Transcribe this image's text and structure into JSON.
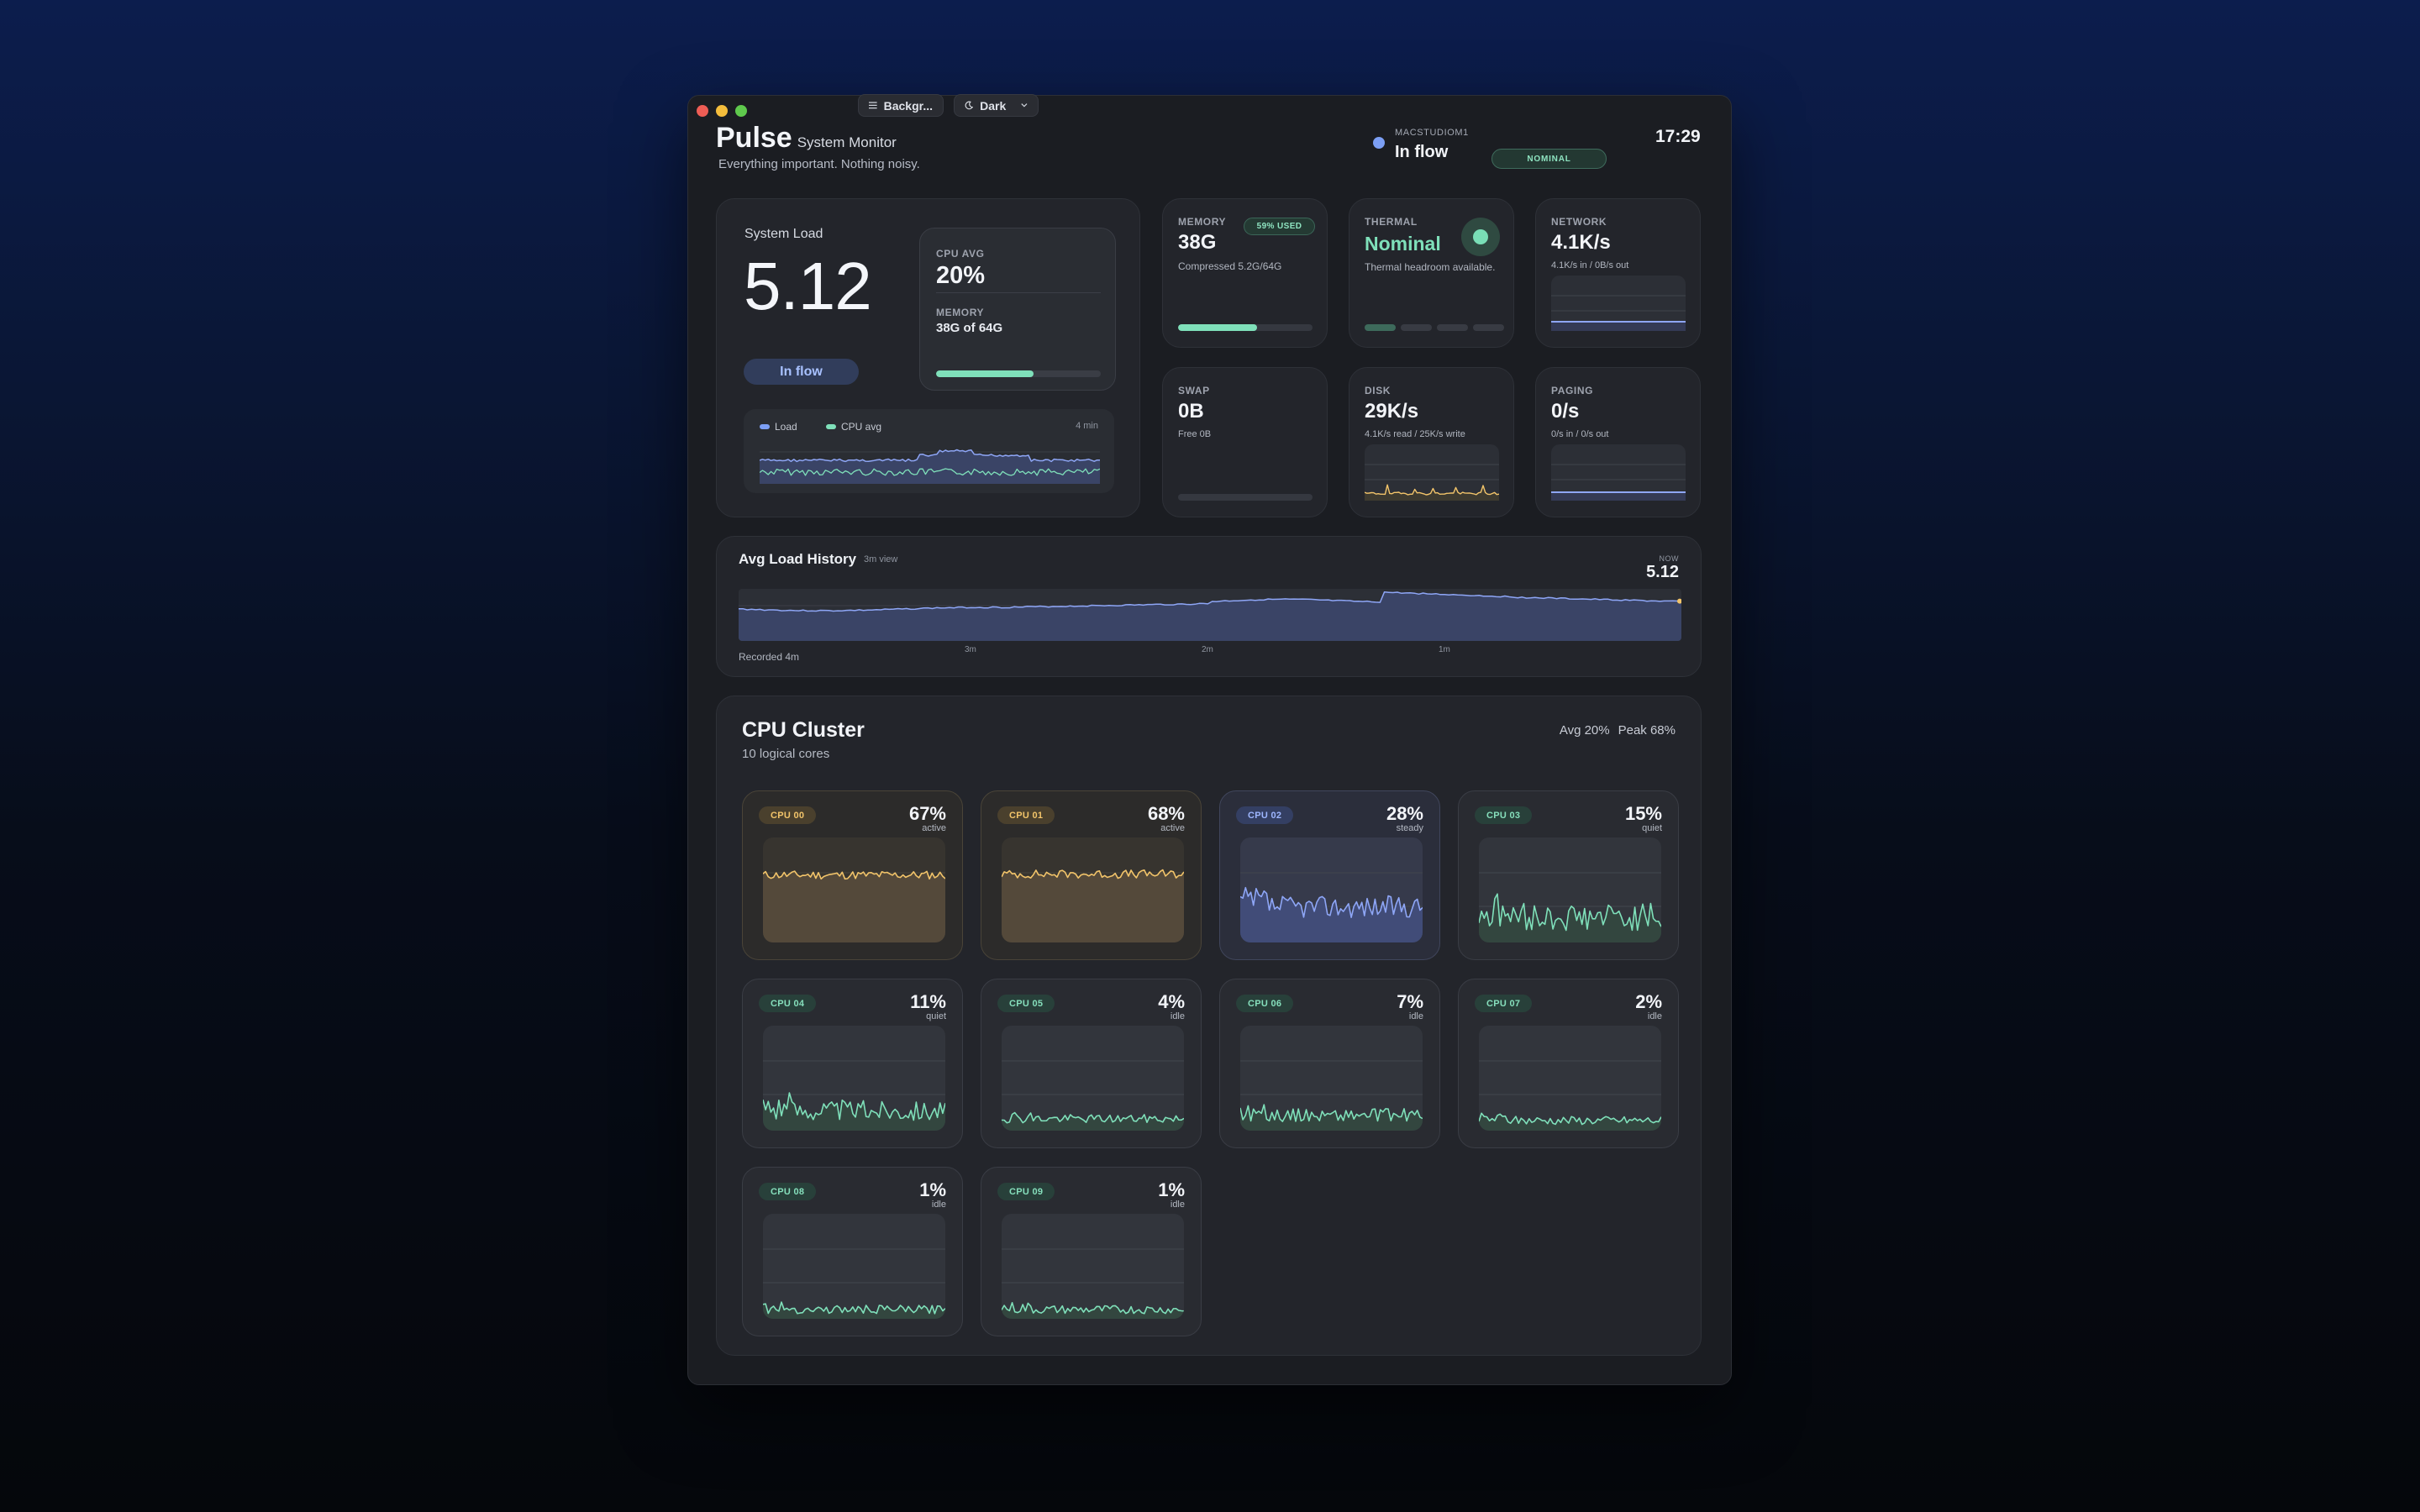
{
  "window": {
    "toolbar": {
      "background_label": "Backgr...",
      "theme_label": "Dark"
    }
  },
  "header": {
    "app_name": "Pulse",
    "app_subtitle": "System Monitor",
    "tagline": "Everything important. Nothing noisy.",
    "host_name": "MACSTUDIOM1",
    "host_state": "In flow",
    "status_badge": "NOMINAL",
    "clock": "17:29"
  },
  "system_load": {
    "title": "System Load",
    "value": "5.12",
    "state": "In flow",
    "cpu_avg_label": "CPU AVG",
    "cpu_avg_value": "20%",
    "memory_label": "MEMORY",
    "memory_value": "38G of 64G",
    "memory_fraction": 0.59,
    "legend_load": "Load",
    "legend_cpu": "CPU avg",
    "window_label": "4 min"
  },
  "tiles": {
    "memory": {
      "label": "MEMORY",
      "value": "38G",
      "desc": "Compressed 5.2G/64G",
      "pill": "59% USED",
      "fraction": 0.59
    },
    "thermal": {
      "label": "THERMAL",
      "value": "Nominal",
      "desc": "Thermal headroom available.",
      "level": 1,
      "levels": 4
    },
    "network": {
      "label": "NETWORK",
      "value": "4.1K/s",
      "desc": "4.1K/s in / 0B/s out"
    },
    "swap": {
      "label": "SWAP",
      "value": "0B",
      "desc": "Free 0B",
      "fraction": 0
    },
    "disk": {
      "label": "DISK",
      "value": "29K/s",
      "desc": "4.1K/s read / 25K/s write"
    },
    "paging": {
      "label": "PAGING",
      "value": "0/s",
      "desc": "0/s in / 0/s out"
    }
  },
  "history": {
    "title": "Avg Load History",
    "span": "3m view",
    "now_label": "NOW",
    "now_value": "5.12",
    "ticks": [
      "3m",
      "2m",
      "1m"
    ],
    "recorded": "Recorded 4m"
  },
  "cluster": {
    "title": "CPU Cluster",
    "subtitle": "10 logical cores",
    "avg": "Avg 20%",
    "peak": "Peak 68%",
    "cores": [
      {
        "name": "CPU 00",
        "pct": "67%",
        "state": "active",
        "value": 67
      },
      {
        "name": "CPU 01",
        "pct": "68%",
        "state": "active",
        "value": 68
      },
      {
        "name": "CPU 02",
        "pct": "28%",
        "state": "steady",
        "value": 28
      },
      {
        "name": "CPU 03",
        "pct": "15%",
        "state": "quiet",
        "value": 15
      },
      {
        "name": "CPU 04",
        "pct": "11%",
        "state": "quiet",
        "value": 11
      },
      {
        "name": "CPU 05",
        "pct": "4%",
        "state": "idle",
        "value": 4
      },
      {
        "name": "CPU 06",
        "pct": "7%",
        "state": "idle",
        "value": 7
      },
      {
        "name": "CPU 07",
        "pct": "2%",
        "state": "idle",
        "value": 2
      },
      {
        "name": "CPU 08",
        "pct": "1%",
        "state": "idle",
        "value": 1
      },
      {
        "name": "CPU 09",
        "pct": "1%",
        "state": "idle",
        "value": 1
      }
    ]
  },
  "colors": {
    "accent_blue": "#7c9ff5",
    "accent_green": "#7fe0ba",
    "accent_amber": "#f2c46a"
  }
}
